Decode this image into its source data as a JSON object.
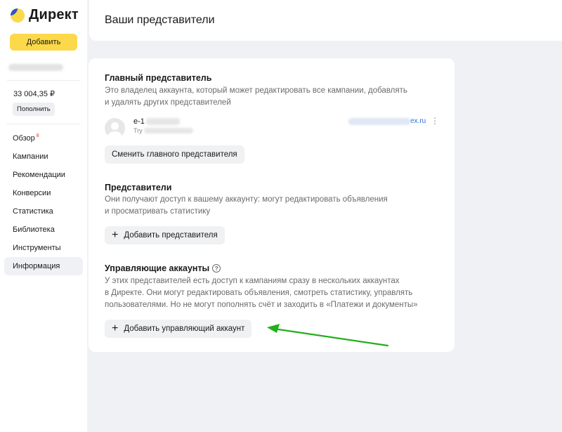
{
  "app": {
    "logo_text": "Директ",
    "add_button": "Добавить",
    "balance": "33 004,35 ₽",
    "topup_button": "Пополнить"
  },
  "nav": [
    {
      "label": "Обзор",
      "badge": "8"
    },
    {
      "label": "Кампании"
    },
    {
      "label": "Рекомендации"
    },
    {
      "label": "Конверсии"
    },
    {
      "label": "Статистика"
    },
    {
      "label": "Библиотека"
    },
    {
      "label": "Инструменты"
    },
    {
      "label": "Информация",
      "active": true
    }
  ],
  "page": {
    "title": "Ваши представители"
  },
  "main_rep": {
    "title": "Главный представитель",
    "desc_line1": "Это владелец аккаунта, который может редактировать все кампании, добавлять",
    "desc_line2": "и удалять других представителей",
    "login_prefix": "e-1",
    "role_prefix": "Try",
    "email_suffix": "ex.ru",
    "change_button": "Сменить главного представителя"
  },
  "reps": {
    "title": "Представители",
    "desc_line1": "Они получают доступ к вашему аккаунту: могут редактировать объявления",
    "desc_line2": "и просматривать статистику",
    "add_button": "Добавить представителя"
  },
  "managing": {
    "title": "Управляющие аккаунты",
    "help_glyph": "?",
    "desc_line1": "У этих представителей есть доступ к кампаниям сразу в нескольких аккаунтах",
    "desc_line2": "в Директе. Они могут редактировать объявления, смотреть статистику, управлять",
    "desc_line3": "пользователями. Но не могут пополнять счёт и заходить в «Платежи и документы»",
    "add_button": "Добавить управляющий аккаунт"
  },
  "icons": {
    "plus": "+",
    "more": "⋮"
  },
  "colors": {
    "accent_yellow": "#fcd94a",
    "annotation_arrow": "#22b01a",
    "link_blue": "#2b6bd6"
  }
}
